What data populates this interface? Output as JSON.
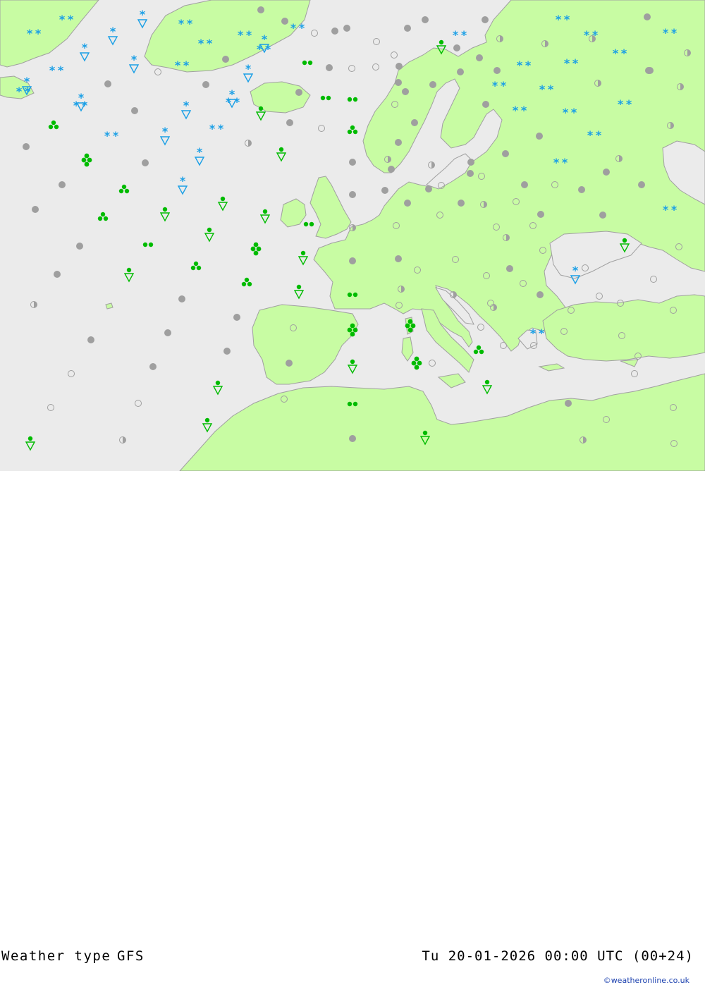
{
  "footer": {
    "title": "Weather type",
    "model": "GFS",
    "datetime": "Tu 20-01-2026 00:00 UTC (00+24)",
    "credit": "©weatheronline.co.uk"
  },
  "colors": {
    "sea": "#ebebeb",
    "land": "#c8fca3",
    "border": "#a0a0a0",
    "snow": "#1a9fe6",
    "rain": "#00bb00",
    "cloud": "#9f9f9f"
  },
  "symbol_legend": {
    "overcast": "filled grey dot",
    "fair": "hollow dot",
    "partly-cloudy": "half-filled dot",
    "snow": "blue asterisks",
    "snow-shower": "blue triangle with asterisk",
    "rain": "green dots",
    "rain-shower": "green triangle with dot"
  }
}
